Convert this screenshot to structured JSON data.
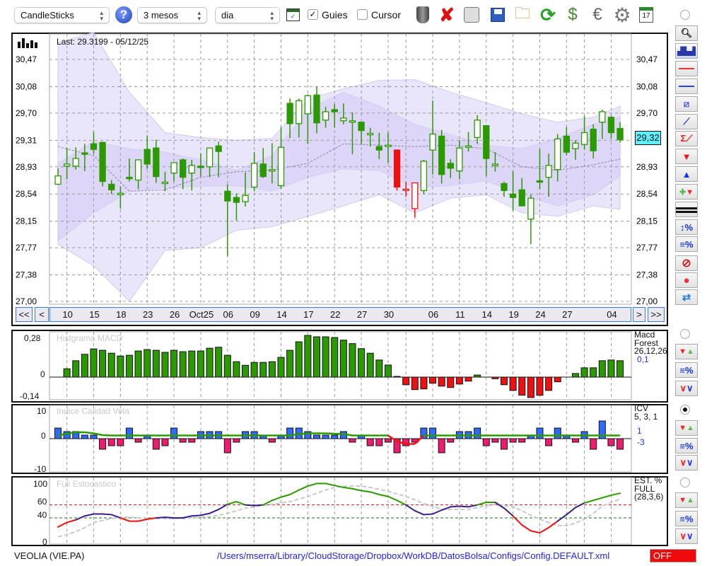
{
  "toolbar": {
    "chart_type": "CandleSticks",
    "help_label": "?",
    "period": "3 mesos",
    "interval": "dia",
    "guides_label": "Guies",
    "guides_checked": true,
    "cursor_label": "Cursor",
    "cursor_checked": false,
    "icons": [
      "trash-icon",
      "delete-icon",
      "print-icon",
      "save-icon",
      "open-folder-icon",
      "refresh-icon",
      "update-data-icon",
      "currency-icon",
      "settings-icon",
      "calendar-icon"
    ],
    "calendar_day": "17"
  },
  "main": {
    "last_label": "Last: 29.3199 - 05/12/25",
    "current_price": "29,32",
    "nav": {
      "first": "<<",
      "prev": "<",
      "next": ">",
      "last": ">>"
    }
  },
  "right_toolbar": [
    "zoom-icon",
    "volume-chart-icon",
    "red-line-icon",
    "blue-line-icon",
    "channel-icon",
    "trend-line-icon",
    "sum-trend-icon",
    "sell-arrow-icon",
    "buy-arrow-icon",
    "add-signal-icon",
    "grid-lines-icon",
    "percent-range-icon",
    "percent-lines-icon",
    "stop-icon",
    "record-icon",
    "sync-icon"
  ],
  "indicators": [
    {
      "name": "Macd",
      "name2": "Forest",
      "params": "26,12,26",
      "value": "0,1",
      "watermark": "Histgrama MACD",
      "selected": false,
      "ticks": [
        "0,28",
        "0",
        "-0,14"
      ]
    },
    {
      "name": "ICV",
      "params": "5, 3, 1",
      "value": "1",
      "value2": "-3",
      "watermark": "Indice Calidad Vela",
      "selected": true,
      "ticks": [
        "10",
        "0",
        "-10"
      ]
    },
    {
      "name": "EST. %",
      "name2": "FULL",
      "params": "(28,3,6)",
      "watermark": "Full Estocastico",
      "selected": false,
      "ticks": [
        "100",
        "60",
        "40",
        "0"
      ]
    }
  ],
  "footer": {
    "symbol": "VEOLIA (VIE.PA)",
    "config_path": "/Users/mserra/Library/CloudStorage/Dropbox/WorkDB/DatosBolsa/Configs/Config.DEFAULT.xml",
    "status": "OFF"
  },
  "colors": {
    "up": "#2a9a00",
    "down_alert": "#ee1111",
    "band_outer": "#e6e1fb",
    "band_inner": "#d9d1f8",
    "macd_pos": "#2a9a00",
    "macd_neg": "#ee1111",
    "icv_pos": "#2f6bff",
    "icv_neg": "#ee1a6e"
  },
  "chart_data": [
    {
      "type": "candlestick",
      "title": "VEOLIA (VIE.PA)",
      "ylim": [
        27.0,
        30.47
      ],
      "y_ticks": [
        "30,47",
        "30,08",
        "29,70",
        "29,31",
        "28,93",
        "28,54",
        "28,15",
        "27,77",
        "27,38",
        "27,00"
      ],
      "y_tick_values": [
        30.47,
        30.08,
        29.7,
        29.31,
        28.93,
        28.54,
        28.15,
        27.77,
        27.38,
        27.0
      ],
      "x_labels": [
        {
          "i": 1,
          "t": "10"
        },
        {
          "i": 4,
          "t": "15"
        },
        {
          "i": 7,
          "t": "18"
        },
        {
          "i": 10,
          "t": "23"
        },
        {
          "i": 13,
          "t": "26"
        },
        {
          "i": 16,
          "t": "Oct25"
        },
        {
          "i": 19,
          "t": "06"
        },
        {
          "i": 22,
          "t": "09"
        },
        {
          "i": 25,
          "t": "14"
        },
        {
          "i": 28,
          "t": "17"
        },
        {
          "i": 31,
          "t": "22"
        },
        {
          "i": 34,
          "t": "27"
        },
        {
          "i": 37,
          "t": "30"
        },
        {
          "i": 42,
          "t": "06"
        },
        {
          "i": 45,
          "t": "11"
        },
        {
          "i": 48,
          "t": "14"
        },
        {
          "i": 51,
          "t": "19"
        },
        {
          "i": 54,
          "t": "24"
        },
        {
          "i": 57,
          "t": "27"
        },
        {
          "i": 62,
          "t": "04"
        }
      ],
      "extra_grid_indices": [
        39,
        59
      ],
      "alert_indices": [
        38,
        39,
        40
      ],
      "ohlc": [
        [
          28.68,
          28.91,
          28.67,
          28.8
        ],
        [
          28.94,
          29.2,
          28.75,
          28.97
        ],
        [
          28.94,
          29.21,
          28.89,
          29.05
        ],
        [
          29.13,
          29.26,
          28.87,
          29.12
        ],
        [
          29.26,
          29.43,
          29.12,
          29.18
        ],
        [
          29.28,
          29.29,
          28.65,
          28.72
        ],
        [
          28.68,
          28.74,
          28.54,
          28.6
        ],
        [
          28.55,
          28.65,
          28.33,
          28.55
        ],
        [
          28.78,
          29.05,
          28.72,
          28.76
        ],
        [
          28.74,
          29.03,
          28.61,
          29.03
        ],
        [
          29.18,
          29.38,
          28.9,
          28.97
        ],
        [
          29.2,
          29.32,
          28.7,
          28.79
        ],
        [
          28.69,
          28.86,
          28.58,
          28.71
        ],
        [
          28.84,
          28.99,
          28.72,
          28.99
        ],
        [
          29.03,
          29.05,
          28.61,
          28.78
        ],
        [
          28.84,
          29.03,
          28.59,
          28.95
        ],
        [
          28.94,
          29.12,
          28.79,
          28.93
        ],
        [
          28.93,
          29.2,
          28.78,
          29.2
        ],
        [
          29.23,
          29.29,
          28.78,
          29.15
        ],
        [
          28.58,
          28.68,
          27.65,
          28.44
        ],
        [
          28.49,
          28.55,
          28.16,
          28.42
        ],
        [
          28.43,
          28.85,
          28.36,
          28.52
        ],
        [
          28.64,
          29.14,
          28.58,
          28.98
        ],
        [
          28.97,
          29.2,
          28.77,
          28.79
        ],
        [
          28.87,
          29.27,
          28.69,
          28.89
        ],
        [
          28.66,
          29.5,
          28.62,
          29.21
        ],
        [
          29.84,
          29.91,
          29.34,
          29.55
        ],
        [
          29.55,
          29.91,
          29.35,
          29.88
        ],
        [
          29.69,
          29.97,
          29.26,
          29.95
        ],
        [
          29.96,
          30.08,
          29.41,
          29.56
        ],
        [
          29.6,
          29.79,
          29.49,
          29.72
        ],
        [
          29.75,
          29.83,
          29.49,
          29.72
        ],
        [
          29.59,
          29.84,
          29.54,
          29.63
        ],
        [
          29.59,
          29.71,
          29.11,
          29.59
        ],
        [
          29.57,
          29.57,
          29.25,
          29.45
        ],
        [
          29.39,
          29.49,
          29.22,
          29.41
        ],
        [
          29.22,
          29.42,
          29.04,
          29.17
        ],
        [
          29.24,
          29.42,
          28.98,
          29.24
        ],
        [
          29.17,
          29.18,
          28.59,
          28.64
        ],
        [
          28.61,
          28.71,
          28.5,
          28.61
        ],
        [
          28.33,
          28.7,
          28.2,
          28.7
        ],
        [
          28.59,
          29.03,
          28.54,
          29.01
        ],
        [
          29.17,
          29.88,
          28.82,
          29.4
        ],
        [
          29.37,
          29.46,
          28.69,
          28.82
        ],
        [
          28.98,
          29.04,
          28.77,
          28.91
        ],
        [
          28.87,
          29.31,
          28.75,
          29.2
        ],
        [
          29.21,
          29.43,
          29.15,
          29.23
        ],
        [
          29.35,
          29.67,
          29.26,
          29.6
        ],
        [
          29.52,
          29.52,
          28.8,
          29.05
        ],
        [
          28.97,
          29.14,
          28.86,
          28.97
        ],
        [
          28.69,
          28.72,
          28.5,
          28.59
        ],
        [
          28.54,
          28.87,
          28.3,
          28.49
        ],
        [
          28.6,
          28.77,
          28.36,
          28.37
        ],
        [
          28.18,
          28.53,
          27.82,
          28.48
        ],
        [
          28.73,
          29.18,
          28.61,
          28.72
        ],
        [
          28.78,
          29.12,
          28.5,
          28.95
        ],
        [
          28.89,
          29.4,
          28.72,
          29.33
        ],
        [
          29.37,
          29.5,
          29.1,
          29.14
        ],
        [
          29.19,
          29.31,
          29.03,
          29.27
        ],
        [
          29.25,
          29.66,
          29.18,
          29.42
        ],
        [
          29.47,
          29.54,
          29.05,
          29.16
        ],
        [
          29.57,
          29.75,
          29.33,
          29.72
        ],
        [
          29.64,
          29.66,
          29.33,
          29.42
        ],
        [
          29.48,
          29.57,
          29.28,
          29.32
        ]
      ],
      "bands": {
        "sample_indices": [
          0,
          4,
          8,
          12,
          16,
          20,
          24,
          28,
          32,
          36,
          40,
          44,
          48,
          52,
          56,
          60,
          63
        ],
        "upper_outer": [
          30.71,
          30.86,
          30.0,
          29.42,
          29.35,
          29.31,
          29.34,
          29.9,
          30.05,
          30.17,
          30.18,
          30.0,
          29.85,
          29.69,
          29.57,
          29.64,
          29.8
        ],
        "upper_inner": [
          28.98,
          29.29,
          29.19,
          29.14,
          29.03,
          28.88,
          29.09,
          29.75,
          30.0,
          29.8,
          29.54,
          29.39,
          29.24,
          29.19,
          29.34,
          29.54,
          29.64
        ],
        "middle": [
          29.22,
          29.09,
          28.58,
          28.6,
          28.78,
          28.86,
          28.88,
          28.98,
          29.26,
          29.24,
          29.22,
          29.24,
          29.19,
          28.93,
          28.88,
          28.96,
          29.04
        ],
        "lower_inner": [
          27.87,
          28.27,
          28.58,
          28.63,
          28.65,
          28.66,
          28.58,
          28.78,
          28.9,
          28.88,
          28.63,
          28.66,
          28.73,
          28.53,
          28.37,
          28.53,
          28.8
        ],
        "lower_outer": [
          27.82,
          27.51,
          27.0,
          27.73,
          27.77,
          28.02,
          28.07,
          28.22,
          28.37,
          28.53,
          28.27,
          28.48,
          28.53,
          28.27,
          28.22,
          28.37,
          28.32
        ]
      }
    },
    {
      "type": "bar",
      "title": "Histgrama MACD",
      "ylim": [
        -0.14,
        0.28
      ],
      "values": [
        null,
        0.06,
        0.118,
        0.164,
        0.203,
        0.193,
        0.172,
        0.152,
        0.157,
        0.188,
        0.198,
        0.193,
        0.178,
        0.193,
        0.183,
        0.188,
        0.188,
        0.208,
        0.215,
        0.157,
        0.111,
        0.085,
        0.106,
        0.106,
        0.111,
        0.142,
        0.193,
        0.254,
        0.3,
        0.29,
        0.29,
        0.285,
        0.266,
        0.241,
        0.205,
        0.172,
        0.123,
        0.087,
        0.005,
        -0.055,
        -0.09,
        -0.085,
        -0.044,
        -0.065,
        -0.075,
        -0.05,
        -0.029,
        0.015,
        0,
        -0.012,
        -0.055,
        -0.096,
        -0.13,
        -0.147,
        -0.131,
        -0.096,
        -0.034,
        0,
        0.026,
        0.067,
        0.067,
        0.118,
        0.123,
        0.118
      ]
    },
    {
      "type": "bar",
      "title": "Indice Calidad Vela",
      "ylim": [
        -10,
        10
      ],
      "values": [
        3,
        2,
        2,
        1,
        1,
        -3,
        -2,
        -2,
        3,
        -1,
        1,
        -3,
        -2,
        3,
        -1,
        -1,
        2,
        2,
        2,
        -4,
        -1,
        2,
        2,
        1,
        -1,
        1,
        3,
        3,
        2,
        1,
        1,
        1,
        2,
        -1,
        1,
        -2,
        -2,
        -1,
        -4,
        -2,
        -1,
        3,
        3,
        -4,
        -1,
        2,
        2,
        3,
        -2,
        -1,
        -3,
        -1,
        -1,
        1,
        3,
        -2,
        3,
        1,
        -1,
        2,
        -3,
        5,
        -2,
        -3
      ],
      "signal": [
        0.9,
        1.4,
        1.8,
        1.8,
        1.5,
        1.0,
        0.9,
        0.9,
        0.9,
        0.9,
        0.9,
        0.9,
        0.9,
        0.9,
        0.9,
        0.9,
        0.9,
        0.9,
        0.9,
        0.9,
        0.9,
        0.9,
        0.9,
        0.9,
        0.9,
        0.9,
        0.9,
        1.3,
        1.5,
        1.5,
        1.5,
        1.4,
        1.3,
        0.9,
        0.9,
        0.9,
        0.9,
        0.9,
        -0.8,
        -1.5,
        -1.5,
        0.9,
        0.9,
        0.9,
        0.9,
        0.9,
        0.9,
        0.9,
        0.9,
        0.9,
        0.9,
        0.9,
        0.9,
        0.9,
        0.9,
        0.9,
        0.9,
        0.9,
        0.9,
        0.9,
        0.9,
        0.9,
        0.9,
        0.9
      ]
    },
    {
      "type": "line",
      "title": "Full Estocastico",
      "ylim": [
        0,
        100
      ],
      "levels": [
        60,
        40
      ],
      "k": [
        26,
        33,
        37,
        43,
        46,
        46,
        45,
        40,
        35,
        35,
        38,
        40,
        41,
        40,
        40,
        43,
        44,
        47,
        53,
        61,
        65,
        60,
        59,
        60,
        67,
        72,
        76,
        83,
        89,
        93,
        93,
        90,
        87,
        85,
        82,
        80,
        76,
        73,
        67,
        60,
        51,
        45,
        46,
        52,
        57,
        58,
        57,
        60,
        64,
        64,
        55,
        43,
        29,
        20,
        17,
        25,
        35,
        45,
        56,
        63,
        67,
        71,
        75,
        78
      ],
      "d": [
        11,
        14,
        19,
        25,
        33,
        36,
        39,
        41,
        41,
        40,
        39,
        39,
        39,
        39,
        39,
        40,
        41,
        42,
        44,
        47,
        51,
        55,
        57,
        59,
        61,
        63,
        65,
        69,
        73,
        78,
        83,
        87,
        89,
        89,
        89,
        87,
        84,
        81,
        77,
        73,
        68,
        62,
        58,
        53,
        53,
        53,
        53,
        56,
        59,
        61,
        59,
        57,
        51,
        44,
        38,
        33,
        28,
        28,
        32,
        38,
        47,
        58,
        64,
        69
      ]
    }
  ]
}
